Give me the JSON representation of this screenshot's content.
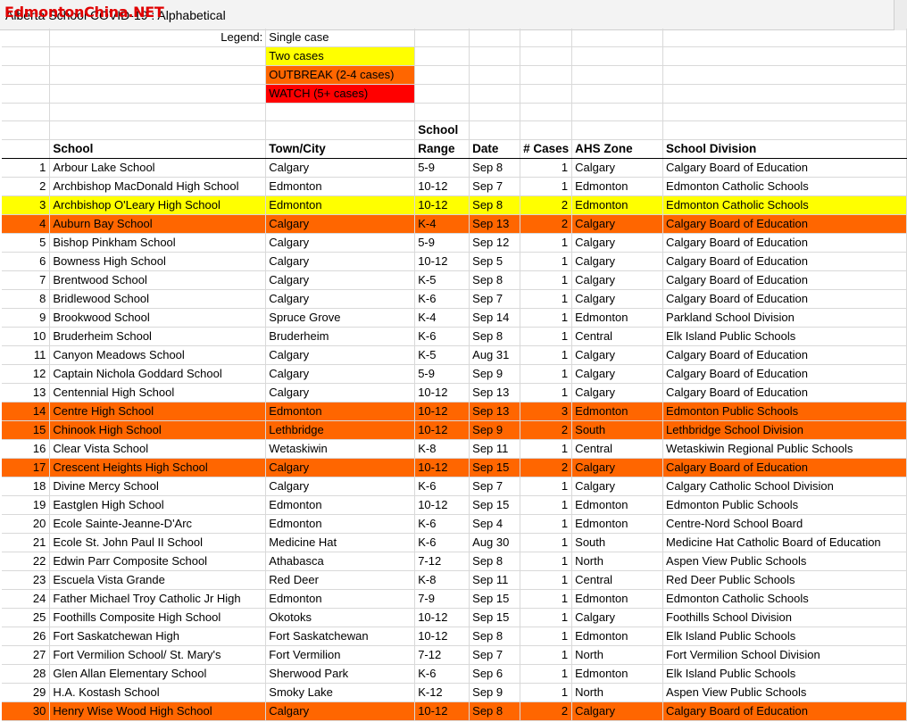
{
  "window": {
    "title": "Alberta School COVID-19 : Alphabetical",
    "watermark": "EdmontonChina.NET"
  },
  "legend": {
    "label": "Legend:",
    "single": "Single case",
    "two": "Two cases",
    "outbreak": "OUTBREAK (2-4 cases)",
    "watch": "WATCH (5+ cases)"
  },
  "headers": {
    "school_top": "School",
    "school": "School",
    "town": "Town/City",
    "range": "Range",
    "date": "Date",
    "cases": "# Cases",
    "zone": "AHS Zone",
    "division": "School Division"
  },
  "colors": {
    "two_cases": "#ffff00",
    "outbreak": "#ff6600",
    "watch": "#ff0000"
  },
  "rows": [
    {
      "n": "1",
      "school": "Arbour Lake School",
      "town": "Calgary",
      "range": "5-9",
      "date": "Sep 8",
      "cases": "1",
      "zone": "Calgary",
      "division": "Calgary Board of Education",
      "level": "single"
    },
    {
      "n": "2",
      "school": "Archbishop MacDonald High School",
      "town": "Edmonton",
      "range": "10-12",
      "date": "Sep 7",
      "cases": "1",
      "zone": "Edmonton",
      "division": "Edmonton Catholic Schools",
      "level": "single"
    },
    {
      "n": "3",
      "school": "Archbishop O'Leary High School",
      "town": "Edmonton",
      "range": "10-12",
      "date": "Sep 8",
      "cases": "2",
      "zone": "Edmonton",
      "division": "Edmonton Catholic Schools",
      "level": "yellow"
    },
    {
      "n": "4",
      "school": "Auburn Bay School",
      "town": "Calgary",
      "range": "K-4",
      "date": "Sep 13",
      "cases": "2",
      "zone": "Calgary",
      "division": "Calgary Board of Education",
      "level": "orange"
    },
    {
      "n": "5",
      "school": "Bishop Pinkham School",
      "town": "Calgary",
      "range": "5-9",
      "date": "Sep 12",
      "cases": "1",
      "zone": "Calgary",
      "division": "Calgary Board of Education",
      "level": "single"
    },
    {
      "n": "6",
      "school": "Bowness High School",
      "town": "Calgary",
      "range": "10-12",
      "date": "Sep 5",
      "cases": "1",
      "zone": "Calgary",
      "division": "Calgary Board of Education",
      "level": "single"
    },
    {
      "n": "7",
      "school": "Brentwood School",
      "town": "Calgary",
      "range": "K-5",
      "date": "Sep 8",
      "cases": "1",
      "zone": "Calgary",
      "division": "Calgary Board of Education",
      "level": "single"
    },
    {
      "n": "8",
      "school": "Bridlewood School",
      "town": "Calgary",
      "range": "K-6",
      "date": "Sep 7",
      "cases": "1",
      "zone": "Calgary",
      "division": "Calgary Board of Education",
      "level": "single"
    },
    {
      "n": "9",
      "school": "Brookwood School",
      "town": "Spruce Grove",
      "range": "K-4",
      "date": "Sep 14",
      "cases": "1",
      "zone": "Edmonton",
      "division": "Parkland School Division",
      "level": "single"
    },
    {
      "n": "10",
      "school": "Bruderheim School",
      "town": "Bruderheim",
      "range": "K-6",
      "date": "Sep 8",
      "cases": "1",
      "zone": "Central",
      "division": "Elk Island Public Schools",
      "level": "single"
    },
    {
      "n": "11",
      "school": "Canyon Meadows School",
      "town": "Calgary",
      "range": "K-5",
      "date": "Aug 31",
      "cases": "1",
      "zone": "Calgary",
      "division": "Calgary Board of Education",
      "level": "single"
    },
    {
      "n": "12",
      "school": "Captain Nichola Goddard School",
      "town": "Calgary",
      "range": "5-9",
      "date": "Sep 9",
      "cases": "1",
      "zone": "Calgary",
      "division": "Calgary Board of Education",
      "level": "single"
    },
    {
      "n": "13",
      "school": "Centennial High School",
      "town": "Calgary",
      "range": "10-12",
      "date": "Sep 13",
      "cases": "1",
      "zone": "Calgary",
      "division": "Calgary Board of Education",
      "level": "single"
    },
    {
      "n": "14",
      "school": "Centre High School",
      "town": "Edmonton",
      "range": "10-12",
      "date": "Sep 13",
      "cases": "3",
      "zone": "Edmonton",
      "division": "Edmonton Public Schools",
      "level": "orange"
    },
    {
      "n": "15",
      "school": "Chinook High School",
      "town": "Lethbridge",
      "range": "10-12",
      "date": "Sep 9",
      "cases": "2",
      "zone": "South",
      "division": "Lethbridge School Division",
      "level": "orange"
    },
    {
      "n": "16",
      "school": "Clear Vista School",
      "town": "Wetaskiwin",
      "range": "K-8",
      "date": "Sep 11",
      "cases": "1",
      "zone": "Central",
      "division": "Wetaskiwin Regional Public Schools",
      "level": "single"
    },
    {
      "n": "17",
      "school": "Crescent Heights High School",
      "town": "Calgary",
      "range": "10-12",
      "date": "Sep 15",
      "cases": "2",
      "zone": "Calgary",
      "division": "Calgary Board of Education",
      "level": "orange"
    },
    {
      "n": "18",
      "school": "Divine Mercy School",
      "town": "Calgary",
      "range": "K-6",
      "date": "Sep 7",
      "cases": "1",
      "zone": "Calgary",
      "division": "Calgary Catholic School Division",
      "level": "single"
    },
    {
      "n": "19",
      "school": "Eastglen High School",
      "town": "Edmonton",
      "range": "10-12",
      "date": "Sep 15",
      "cases": "1",
      "zone": "Edmonton",
      "division": "Edmonton Public Schools",
      "level": "single"
    },
    {
      "n": "20",
      "school": "Ecole Sainte-Jeanne-D'Arc",
      "town": "Edmonton",
      "range": "K-6",
      "date": "Sep 4",
      "cases": "1",
      "zone": "Edmonton",
      "division": "Centre-Nord School Board",
      "level": "single"
    },
    {
      "n": "21",
      "school": "Ecole St. John Paul II School",
      "town": "Medicine Hat",
      "range": "K-6",
      "date": "Aug 30",
      "cases": "1",
      "zone": "South",
      "division": "Medicine Hat Catholic Board of Education",
      "level": "single"
    },
    {
      "n": "22",
      "school": "Edwin Parr Composite School",
      "town": "Athabasca",
      "range": "7-12",
      "date": "Sep 8",
      "cases": "1",
      "zone": "North",
      "division": "Aspen View Public Schools",
      "level": "single"
    },
    {
      "n": "23",
      "school": "Escuela Vista Grande",
      "town": "Red Deer",
      "range": "K-8",
      "date": "Sep 11",
      "cases": "1",
      "zone": "Central",
      "division": "Red Deer Public Schools",
      "level": "single"
    },
    {
      "n": "24",
      "school": "Father Michael Troy Catholic Jr High",
      "town": "Edmonton",
      "range": "7-9",
      "date": "Sep 15",
      "cases": "1",
      "zone": "Edmonton",
      "division": "Edmonton Catholic Schools",
      "level": "single"
    },
    {
      "n": "25",
      "school": "Foothills Composite High School",
      "town": "Okotoks",
      "range": "10-12",
      "date": "Sep 15",
      "cases": "1",
      "zone": "Calgary",
      "division": "Foothills School Division",
      "level": "single"
    },
    {
      "n": "26",
      "school": "Fort Saskatchewan High",
      "town": "Fort Saskatchewan",
      "range": "10-12",
      "date": "Sep 8",
      "cases": "1",
      "zone": "Edmonton",
      "division": "Elk Island Public Schools",
      "level": "single"
    },
    {
      "n": "27",
      "school": "Fort Vermilion School/ St. Mary's",
      "town": "Fort Vermilion",
      "range": "7-12",
      "date": "Sep 7",
      "cases": "1",
      "zone": "North",
      "division": "Fort Vermilion School Division",
      "level": "single"
    },
    {
      "n": "28",
      "school": "Glen Allan Elementary School",
      "town": "Sherwood Park",
      "range": "K-6",
      "date": "Sep 6",
      "cases": "1",
      "zone": "Edmonton",
      "division": "Elk Island Public Schools",
      "level": "single"
    },
    {
      "n": "29",
      "school": "H.A. Kostash School",
      "town": "Smoky Lake",
      "range": "K-12",
      "date": "Sep 9",
      "cases": "1",
      "zone": "North",
      "division": "Aspen View Public Schools",
      "level": "single"
    },
    {
      "n": "30",
      "school": "Henry Wise Wood High School",
      "town": "Calgary",
      "range": "10-12",
      "date": "Sep 8",
      "cases": "2",
      "zone": "Calgary",
      "division": "Calgary Board of Education",
      "level": "orange"
    }
  ]
}
